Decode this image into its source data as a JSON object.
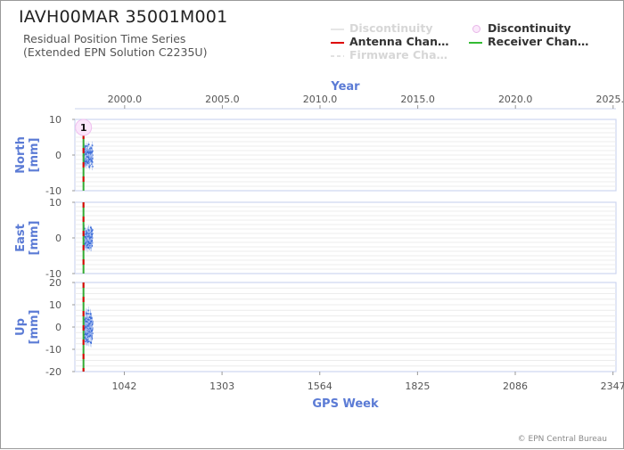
{
  "header": {
    "title": "IAVH00MAR 35001M001",
    "subtitle_line1": "Residual Position Time Series",
    "subtitle_line2": "(Extended EPN Solution C2235U)"
  },
  "legend": [
    {
      "label": "Discontinuity",
      "style": "line-faded",
      "color": "#e4e4e4"
    },
    {
      "label": "Discontinuity",
      "style": "circle",
      "color": "#f2c9f2"
    },
    {
      "label": "Antenna Chan…",
      "style": "line",
      "color": "#dd0000"
    },
    {
      "label": "Receiver Chan…",
      "style": "line",
      "color": "#33bb33"
    },
    {
      "label": "Firmware Cha…",
      "style": "dashed-faded",
      "color": "#e4e4e4"
    }
  ],
  "footer": "© EPN Central Bureau",
  "chart_data": {
    "type": "scatter",
    "top_axis": {
      "title": "Year",
      "ticks": [
        "2000.0",
        "2005.0",
        "2010.0",
        "2015.0",
        "2020.0",
        "2025.0"
      ],
      "tick_values": [
        2000.0,
        2005.0,
        2010.0,
        2015.0,
        2020.0,
        2025.0
      ]
    },
    "bottom_axis": {
      "title": "GPS Week",
      "ticks": [
        "1042",
        "1303",
        "1564",
        "1825",
        "2086",
        "2347"
      ],
      "tick_values": [
        1042,
        1303,
        1564,
        1825,
        2086,
        2347
      ]
    },
    "x_range_gps_week": [
      910,
      2355
    ],
    "discontinuity_week": 933,
    "discontinuity_label": "1",
    "data_week_range": [
      933,
      957
    ],
    "panels": [
      {
        "name": "North",
        "ylabel": "North\n[mm]",
        "ylim": [
          -10,
          10
        ],
        "yticks": [
          "10",
          "0",
          "-10"
        ],
        "ytick_values": [
          10,
          0,
          -10
        ],
        "data_center": 0,
        "data_spread": 2
      },
      {
        "name": "East",
        "ylabel": "East\n[mm]",
        "ylim": [
          -10,
          10
        ],
        "yticks": [
          "10",
          "0",
          "-10"
        ],
        "ytick_values": [
          10,
          0,
          -10
        ],
        "data_center": 0,
        "data_spread": 2
      },
      {
        "name": "Up",
        "ylabel": "Up\n[mm]",
        "ylim": [
          -20,
          20
        ],
        "yticks": [
          "20",
          "10",
          "0",
          "-10",
          "-20"
        ],
        "ytick_values": [
          20,
          10,
          0,
          -10,
          -20
        ],
        "data_center": 0,
        "data_spread": 5
      }
    ],
    "point_color": "#3a6bd8",
    "grid": true
  }
}
